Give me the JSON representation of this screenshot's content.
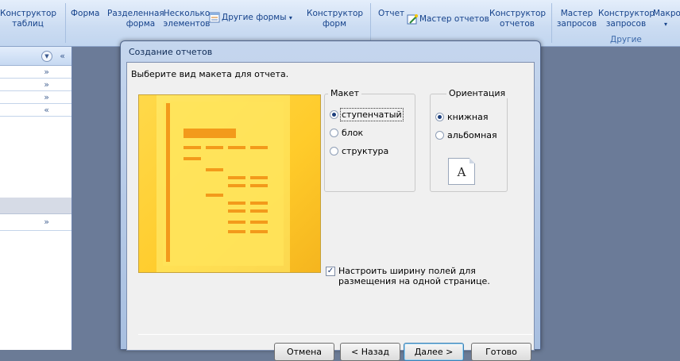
{
  "ribbon": {
    "table_designer": [
      "Конструктор",
      "таблиц"
    ],
    "form": "Форма",
    "split_form": [
      "Разделенная",
      "форма"
    ],
    "multiple_items": [
      "Несколько",
      "элементов"
    ],
    "other_forms": "Другие формы",
    "form_designer": [
      "Конструктор",
      "форм"
    ],
    "report": "Отчет",
    "report_wizard": "Мастер отчетов",
    "report_designer": [
      "Конструктор",
      "отчетов"
    ],
    "query_wizard": [
      "Мастер",
      "запросов"
    ],
    "query_designer": [
      "Конструктор",
      "запросов"
    ],
    "macro": "Макро",
    "group_other": "Другие"
  },
  "dialog": {
    "title": "Создание отчетов",
    "prompt": "Выберите вид макета для отчета.",
    "layout_group": "Макет",
    "layout_options": [
      {
        "label": "ступенчатый",
        "selected": true
      },
      {
        "label": "блок",
        "selected": false
      },
      {
        "label": "структура",
        "selected": false
      }
    ],
    "orientation_group": "Ориентация",
    "orientation_options": [
      {
        "label": "книжная",
        "selected": true
      },
      {
        "label": "альбомная",
        "selected": false
      }
    ],
    "orientation_icon_letter": "A",
    "fit_width_checked": true,
    "fit_width_label": "Настроить ширину полей для размещения на одной странице.",
    "buttons": {
      "cancel": "Отмена",
      "back": "< Назад",
      "next": "Далее >",
      "finish": "Готово"
    }
  },
  "colors": {
    "preview_yellow": "#ffcb2a",
    "preview_orange": "#f4a31c",
    "workspace": "#6b7b98"
  }
}
